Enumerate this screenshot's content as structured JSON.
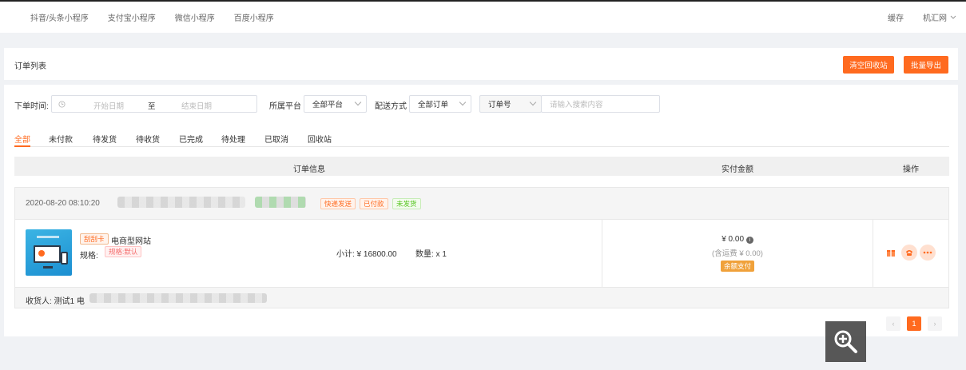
{
  "topnav": {
    "tabs": [
      "抖音/头条小程序",
      "支付宝小程序",
      "微信小程序",
      "百度小程序"
    ],
    "cache_label": "缓存",
    "user_label": "机汇网"
  },
  "header": {
    "title": "订单列表",
    "clear_recycle_label": "清空回收站",
    "batch_export_label": "批量导出"
  },
  "filters": {
    "order_time_label": "下单时间:",
    "start_date_placeholder": "开始日期",
    "range_separator": "至",
    "end_date_placeholder": "结束日期",
    "platform_label": "所属平台",
    "platform_value": "全部平台",
    "delivery_label": "配送方式",
    "delivery_value": "全部订单",
    "search_field_value": "订单号",
    "search_placeholder": "请输入搜索内容"
  },
  "tabs": [
    "全部",
    "未付款",
    "待发货",
    "待收货",
    "已完成",
    "待处理",
    "已取消",
    "回收站"
  ],
  "table_header": {
    "order_info": "订单信息",
    "amount": "实付金额",
    "actions": "操作"
  },
  "order": {
    "datetime": "2020-08-20 08:10:20",
    "tags": [
      "快递发送",
      "已付款",
      "未发货"
    ],
    "product_tag": "刮刮卡",
    "product_name": "电商型网站",
    "spec_label": "规格:",
    "spec_value": "规格:默认",
    "subtotal_label": "小计: ¥ 16800.00",
    "quantity_label": "数量: x 1",
    "amount": "¥ 0.00",
    "shipping_note": "(含运费 ¥ 0.00)",
    "payment_badge": "余额支付",
    "receiver_label": "收货人: 测试1 电"
  },
  "pagination": {
    "current_page": "1",
    "prev": "‹",
    "next": "›"
  },
  "colors": {
    "accent": "#ff6a1f",
    "success": "#52c41a",
    "balance_badge": "#f0a13a"
  },
  "icons": [
    "clock-icon",
    "chevron-down-icon",
    "info-icon",
    "gift-icon",
    "phone-icon",
    "more-icon",
    "zoom-in-icon"
  ]
}
